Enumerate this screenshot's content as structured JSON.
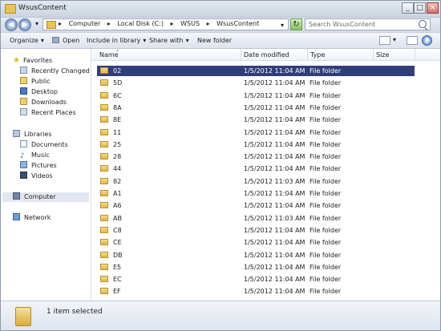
{
  "window": {
    "title": "WsusContent"
  },
  "navigation": {
    "back_symbol": "◀",
    "forward_symbol": "▶",
    "address_separator": "▸",
    "breadcrumbs": [
      "Computer",
      "Local Disk (C:)",
      "WSUS",
      "WsusContent"
    ],
    "search_placeholder": "Search WsusContent"
  },
  "toolbar": {
    "organize": "Organize",
    "open": "Open",
    "include_in_library": "Include in library",
    "share_with": "Share with",
    "new_folder": "New folder"
  },
  "sidebar": {
    "favorites": {
      "label": "Favorites",
      "items": [
        "Recently Changed",
        "Public",
        "Desktop",
        "Downloads",
        "Recent Places"
      ]
    },
    "libraries": {
      "label": "Libraries",
      "items": [
        "Documents",
        "Music",
        "Pictures",
        "Videos"
      ]
    },
    "computer": "Computer",
    "network": "Network"
  },
  "columns": {
    "name": "Name",
    "date_modified": "Date modified",
    "type": "Type",
    "size": "Size",
    "sort_indicator": "˄"
  },
  "files": [
    {
      "name": "02",
      "date": "1/5/2012 11:04 AM",
      "type": "File folder"
    },
    {
      "name": "5D",
      "date": "1/5/2012 11:04 AM",
      "type": "File folder"
    },
    {
      "name": "6C",
      "date": "1/5/2012 11:04 AM",
      "type": "File folder"
    },
    {
      "name": "8A",
      "date": "1/5/2012 11:04 AM",
      "type": "File folder"
    },
    {
      "name": "8E",
      "date": "1/5/2012 11:04 AM",
      "type": "File folder"
    },
    {
      "name": "11",
      "date": "1/5/2012 11:04 AM",
      "type": "File folder"
    },
    {
      "name": "25",
      "date": "1/5/2012 11:04 AM",
      "type": "File folder"
    },
    {
      "name": "28",
      "date": "1/5/2012 11:04 AM",
      "type": "File folder"
    },
    {
      "name": "44",
      "date": "1/5/2012 11:04 AM",
      "type": "File folder"
    },
    {
      "name": "82",
      "date": "1/5/2012 11:03 AM",
      "type": "File folder"
    },
    {
      "name": "A1",
      "date": "1/5/2012 11:04 AM",
      "type": "File folder"
    },
    {
      "name": "A6",
      "date": "1/5/2012 11:04 AM",
      "type": "File folder"
    },
    {
      "name": "AB",
      "date": "1/5/2012 11:03 AM",
      "type": "File folder"
    },
    {
      "name": "C8",
      "date": "1/5/2012 11:04 AM",
      "type": "File folder"
    },
    {
      "name": "CE",
      "date": "1/5/2012 11:04 AM",
      "type": "File folder"
    },
    {
      "name": "DB",
      "date": "1/5/2012 11:04 AM",
      "type": "File folder"
    },
    {
      "name": "E5",
      "date": "1/5/2012 11:04 AM",
      "type": "File folder"
    },
    {
      "name": "EC",
      "date": "1/5/2012 11:04 AM",
      "type": "File folder"
    },
    {
      "name": "EF",
      "date": "1/5/2012 11:04 AM",
      "type": "File folder"
    }
  ],
  "status": {
    "selection_text": "1 item selected"
  },
  "icons": {
    "back": "back-arrow-icon",
    "forward": "forward-arrow-icon",
    "folder": "folder-icon",
    "search": "magnifier-icon",
    "refresh": "refresh-icon",
    "help": "help-icon"
  },
  "colors": {
    "selected_row": "#2f3e7b",
    "window_chrome": "#cfd7e2"
  }
}
